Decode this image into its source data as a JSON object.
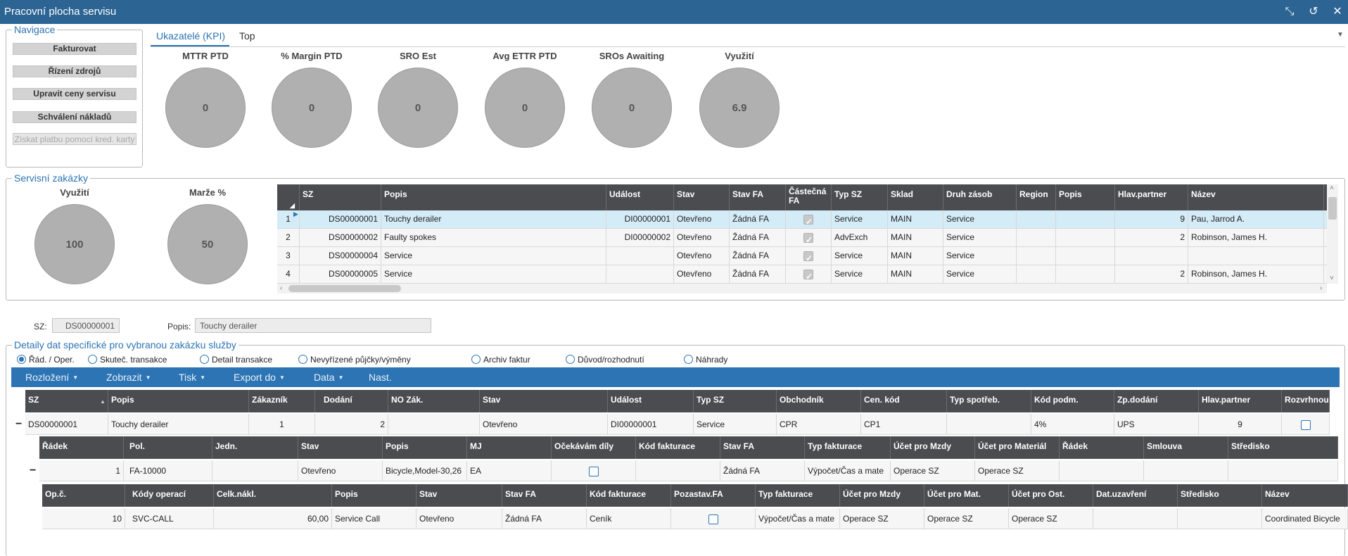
{
  "window": {
    "title": "Pracovní plocha servisu"
  },
  "navigation": {
    "title": "Navigace",
    "buttons": [
      "Fakturovat",
      "Řízení zdrojů",
      "Upravit ceny servisu",
      "Schválení nákladů",
      "Získat platbu pomocí kred. karty"
    ]
  },
  "kpi_tabs": {
    "active": "Ukazatelé (KPI)",
    "other": "Top"
  },
  "kpis": [
    {
      "label": "MTTR PTD",
      "value": "0"
    },
    {
      "label": "% Margin PTD",
      "value": "0"
    },
    {
      "label": "SRO Est",
      "value": "0"
    },
    {
      "label": "Avg ETTR PTD",
      "value": "0"
    },
    {
      "label": "SROs Awaiting",
      "value": "0"
    },
    {
      "label": "Využití",
      "value": "6.9"
    }
  ],
  "service_orders": {
    "title": "Servisní zakázky",
    "gauges": [
      {
        "label": "Využití",
        "value": "100"
      },
      {
        "label": "Marže %",
        "value": "50"
      }
    ],
    "columns": [
      "SZ",
      "Popis",
      "Událost",
      "Stav",
      "Stav FA",
      "Částečná FA",
      "Typ SZ",
      "Sklad",
      "Druh zásob",
      "Region",
      "Popis",
      "Hlav.partner",
      "Název"
    ],
    "rows": [
      {
        "num": "1",
        "sz": "DS00000001",
        "popis": "Touchy derailer",
        "udalost": "DI00000001",
        "stav": "Otevřeno",
        "stavfa": "Žádná FA",
        "typ": "Service",
        "sklad": "MAIN",
        "druh": "Service",
        "region": "",
        "popis2": "",
        "partner": "9",
        "nazev": "Pau, Jarrod A."
      },
      {
        "num": "2",
        "sz": "DS00000002",
        "popis": "Faulty spokes",
        "udalost": "DI00000002",
        "stav": "Otevřeno",
        "stavfa": "Žádná FA",
        "typ": "AdvExch",
        "sklad": "MAIN",
        "druh": "Service",
        "region": "",
        "popis2": "",
        "partner": "2",
        "nazev": "Robinson, James H."
      },
      {
        "num": "3",
        "sz": "DS00000004",
        "popis": "Service",
        "udalost": "",
        "stav": "Otevřeno",
        "stavfa": "Žádná FA",
        "typ": "Service",
        "sklad": "MAIN",
        "druh": "Service",
        "region": "",
        "popis2": "",
        "partner": "",
        "nazev": ""
      },
      {
        "num": "4",
        "sz": "DS00000005",
        "popis": "Service",
        "udalost": "",
        "stav": "Otevřeno",
        "stavfa": "Žádná FA",
        "typ": "Service",
        "sklad": "MAIN",
        "druh": "Service",
        "region": "",
        "popis2": "",
        "partner": "2",
        "nazev": "Robinson, James H."
      }
    ]
  },
  "selection": {
    "sz_label": "SZ:",
    "sz_value": "DS00000001",
    "popis_label": "Popis:",
    "popis_value": "Touchy derailer"
  },
  "details": {
    "title": "Detaily dat specifické pro vybranou zakázku služby",
    "radios": [
      "Řád. / Oper.",
      "Skuteč. transakce",
      "Detail transakce",
      "Nevyřízené půjčky/výměny",
      "Archiv faktur",
      "Důvod/rozhodnutí",
      "Náhrady"
    ],
    "toolbar": [
      "Rozložení",
      "Zobrazit",
      "Tisk",
      "Export do",
      "Data",
      "Nast."
    ],
    "header_columns": [
      "SZ",
      "Popis",
      "Zákazník",
      "Dodání",
      "NO Zák.",
      "Stav",
      "Událost",
      "Typ SZ",
      "Obchodník",
      "Cen. kód",
      "Typ spotřeb.",
      "Kód podm.",
      "Zp.dodání",
      "Hlav.partner",
      "Rozvrhnou"
    ],
    "header_row": {
      "sz": "DS00000001",
      "popis": "Touchy derailer",
      "zakaznik": "1",
      "dodani": "2",
      "nozak": "",
      "stav": "Otevřeno",
      "udalost": "DI00000001",
      "typ": "Service",
      "obchodnik": "CPR",
      "cenkod": "CP1",
      "typspot": "",
      "kodpodm": "4%",
      "zpdodani": "UPS",
      "partner": "9"
    },
    "line_columns": [
      "Řádek",
      "Pol.",
      "Jedn.",
      "Stav",
      "Popis",
      "MJ",
      "Očekávám díly",
      "Kód fakturace",
      "Stav FA",
      "Typ fakturace",
      "Účet pro Mzdy",
      "Účet pro Materiál",
      "Řádek",
      "Smlouva",
      "Středisko"
    ],
    "line_row": {
      "radek": "1",
      "pol": "FA-10000",
      "jedn": "",
      "stav": "Otevřeno",
      "popis": "Bicycle,Model-30,26",
      "mj": "EA",
      "kodfakt": "",
      "stavfa": "Žádná FA",
      "typfakt": "Výpočet/Čas a mate",
      "mzdy": "Operace SZ",
      "material": "Operace SZ"
    },
    "op_columns": [
      "Op.č.",
      "Kódy operací",
      "Celk.nákl.",
      "Popis",
      "Stav",
      "Stav FA",
      "Kód fakturace",
      "Pozastav.FA",
      "Typ fakturace",
      "Účet pro Mzdy",
      "Účet pro Mat.",
      "Účet pro Ost.",
      "Dat.uzavření",
      "Středisko",
      "Název"
    ],
    "op_row": {
      "opc": "10",
      "kody": "SVC-CALL",
      "celk": "60,00",
      "popis": "Service Call",
      "stav": "Otevřeno",
      "stavfa": "Žádná FA",
      "kodfakt": "Ceník",
      "typfakt": "Výpočet/Čas a mate",
      "mzdy": "Operace SZ",
      "mat": "Operace SZ",
      "ost": "Operace SZ",
      "datuz": "",
      "stredisko": "",
      "nazev": "Coordinated Bicycle"
    }
  }
}
